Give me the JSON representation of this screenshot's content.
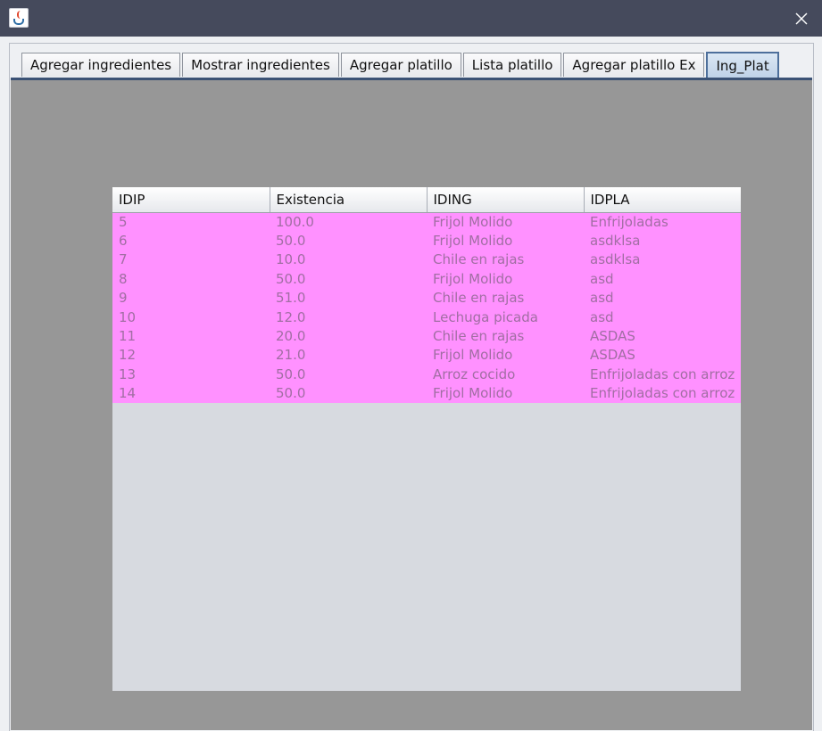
{
  "window": {
    "icon": "java-cup-icon",
    "close_icon": "close-icon"
  },
  "tabs": [
    {
      "label": "Agregar ingredientes",
      "selected": false
    },
    {
      "label": "Mostrar ingredientes",
      "selected": false
    },
    {
      "label": "Agregar platillo",
      "selected": false
    },
    {
      "label": "Lista platillo",
      "selected": false
    },
    {
      "label": "Agregar platillo Ex",
      "selected": false
    },
    {
      "label": "Ing_Plat",
      "selected": true
    }
  ],
  "table": {
    "columns": [
      "IDIP",
      "Existencia",
      "IDING",
      "IDPLA"
    ],
    "rows": [
      [
        "5",
        "100.0",
        "Frijol Molido",
        "Enfrijoladas"
      ],
      [
        "6",
        "50.0",
        "Frijol Molido",
        "asdklsa"
      ],
      [
        "7",
        "10.0",
        "Chile en rajas",
        "asdklsa"
      ],
      [
        "8",
        "50.0",
        "Frijol Molido",
        "asd"
      ],
      [
        "9",
        "51.0",
        "Chile en rajas",
        "asd"
      ],
      [
        "10",
        "12.0",
        "Lechuga picada",
        "asd"
      ],
      [
        "11",
        "20.0",
        "Chile en rajas",
        "ASDAS"
      ],
      [
        "12",
        "21.0",
        "Frijol Molido",
        "ASDAS"
      ],
      [
        "13",
        "50.0",
        "Arroz cocido",
        "Enfrijoladas con arroz"
      ],
      [
        "14",
        "50.0",
        "Frijol Molido",
        "Enfrijoladas con arroz"
      ]
    ]
  },
  "colors": {
    "titlebar": "#454a5c",
    "content_bg": "#979797",
    "row_bg": "#ff91ff",
    "row_text": "#a16ea3",
    "selected_tab": "#bfd2e8"
  }
}
